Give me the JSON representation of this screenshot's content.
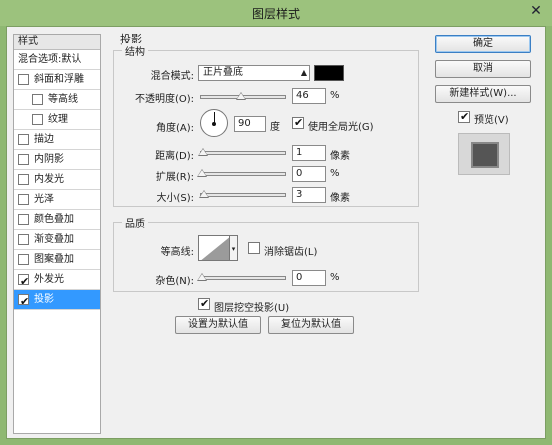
{
  "window": {
    "title": "图层样式",
    "close_glyph": "✕"
  },
  "style_list": {
    "header": "样式",
    "items": [
      {
        "label": "混合选项:默认",
        "checkbox": false,
        "indent": false,
        "checked": false,
        "selected": false
      },
      {
        "label": "斜面和浮雕",
        "checkbox": true,
        "indent": false,
        "checked": false,
        "selected": false
      },
      {
        "label": "等高线",
        "checkbox": true,
        "indent": true,
        "checked": false,
        "selected": false
      },
      {
        "label": "纹理",
        "checkbox": true,
        "indent": true,
        "checked": false,
        "selected": false
      },
      {
        "label": "描边",
        "checkbox": true,
        "indent": false,
        "checked": false,
        "selected": false
      },
      {
        "label": "内阴影",
        "checkbox": true,
        "indent": false,
        "checked": false,
        "selected": false
      },
      {
        "label": "内发光",
        "checkbox": true,
        "indent": false,
        "checked": false,
        "selected": false
      },
      {
        "label": "光泽",
        "checkbox": true,
        "indent": false,
        "checked": false,
        "selected": false
      },
      {
        "label": "颜色叠加",
        "checkbox": true,
        "indent": false,
        "checked": false,
        "selected": false
      },
      {
        "label": "渐变叠加",
        "checkbox": true,
        "indent": false,
        "checked": false,
        "selected": false
      },
      {
        "label": "图案叠加",
        "checkbox": true,
        "indent": false,
        "checked": false,
        "selected": false
      },
      {
        "label": "外发光",
        "checkbox": true,
        "indent": false,
        "checked": true,
        "selected": false
      },
      {
        "label": "投影",
        "checkbox": true,
        "indent": false,
        "checked": true,
        "selected": true
      }
    ]
  },
  "drop_shadow": {
    "panel_title": "投影",
    "structure": {
      "title": "结构",
      "blend_mode_label": "混合模式:",
      "blend_mode_value": "正片叠底",
      "shadow_color": "#000000",
      "opacity_label": "不透明度(O):",
      "opacity_value": "46",
      "opacity_unit": "%",
      "opacity_fraction": 0.46,
      "angle_label": "角度(A):",
      "angle_value": "90",
      "angle_unit": "度",
      "global_light_label": "使用全局光(G)",
      "global_light_checked": true,
      "distance_label": "距离(D):",
      "distance_value": "1",
      "distance_unit": "像素",
      "spread_label": "扩展(R):",
      "spread_value": "0",
      "spread_unit": "%",
      "size_label": "大小(S):",
      "size_value": "3",
      "size_unit": "像素"
    },
    "quality": {
      "title": "品质",
      "contour_label": "等高线:",
      "antialias_label": "消除锯齿(L)",
      "antialias_checked": false,
      "noise_label": "杂色(N):",
      "noise_value": "0",
      "noise_unit": "%"
    },
    "knockout_label": "图层挖空投影(U)",
    "knockout_checked": true,
    "make_default_button": "设置为默认值",
    "reset_default_button": "复位为默认值"
  },
  "actions": {
    "ok": "确定",
    "cancel": "取消",
    "new_style": "新建样式(W)...",
    "preview_label": "预览(V)",
    "preview_checked": true
  },
  "check_glyph": "✔"
}
